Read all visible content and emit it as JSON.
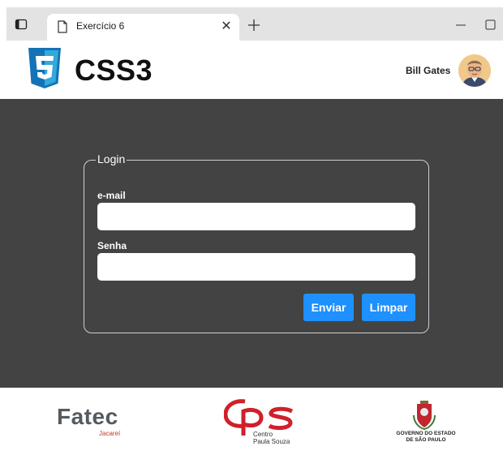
{
  "browser": {
    "tab_title": "Exercício 6"
  },
  "header": {
    "title": "CSS3",
    "username": "Bill Gates"
  },
  "login": {
    "legend": "Login",
    "email_label": "e-mail",
    "email_value": "",
    "password_label": "Senha",
    "password_value": "",
    "submit_label": "Enviar",
    "reset_label": "Limpar"
  },
  "footer": {
    "fatec": "Fatec",
    "fatec_sub": "Jacareí",
    "cps_line1": "Centro",
    "cps_line2": "Paula Souza",
    "gov_line1": "GOVERNO DO ESTADO",
    "gov_line2": "DE SÃO PAULO"
  },
  "colors": {
    "accent": "#1e90ff",
    "main_bg": "#434343",
    "css_logo": "#1572b6",
    "cps_red": "#d0202a"
  }
}
